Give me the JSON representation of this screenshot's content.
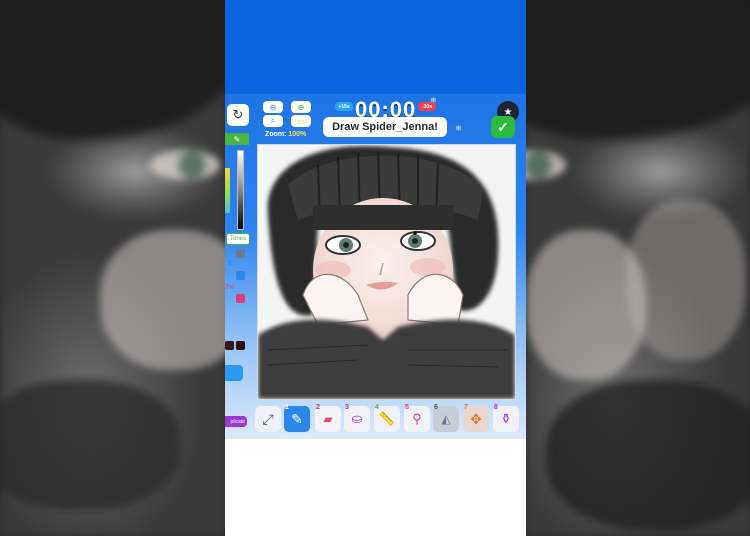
{
  "header": {
    "timer": "00:00",
    "time_plus": "+15s",
    "time_minus": "-30s",
    "prompt": "Draw Spider_Jenna!",
    "zoom_label": "Zoom:",
    "zoom_value": "100%"
  },
  "left_panel": {
    "tones_label": "Tones",
    "small_labels": [
      "5",
      "7%"
    ],
    "duplicate_label": "plicate"
  },
  "toolbar": {
    "tools": [
      {
        "num": "",
        "name": "expand-icon"
      },
      {
        "num": "1",
        "name": "pencil-icon"
      },
      {
        "num": "2",
        "name": "eraser-icon"
      },
      {
        "num": "3",
        "name": "fill-bucket-icon"
      },
      {
        "num": "4",
        "name": "ruler-icon"
      },
      {
        "num": "5",
        "name": "eyedropper-icon"
      },
      {
        "num": "6",
        "name": "mirror-icon"
      },
      {
        "num": "7",
        "name": "move-icon"
      },
      {
        "num": "8",
        "name": "stamp-icon"
      }
    ]
  },
  "colors": {
    "topbar": "#0b63e0",
    "accent_green": "#4bb244",
    "active_tool": "#2a86e8",
    "duplicate_purple": "#9b35d6"
  }
}
